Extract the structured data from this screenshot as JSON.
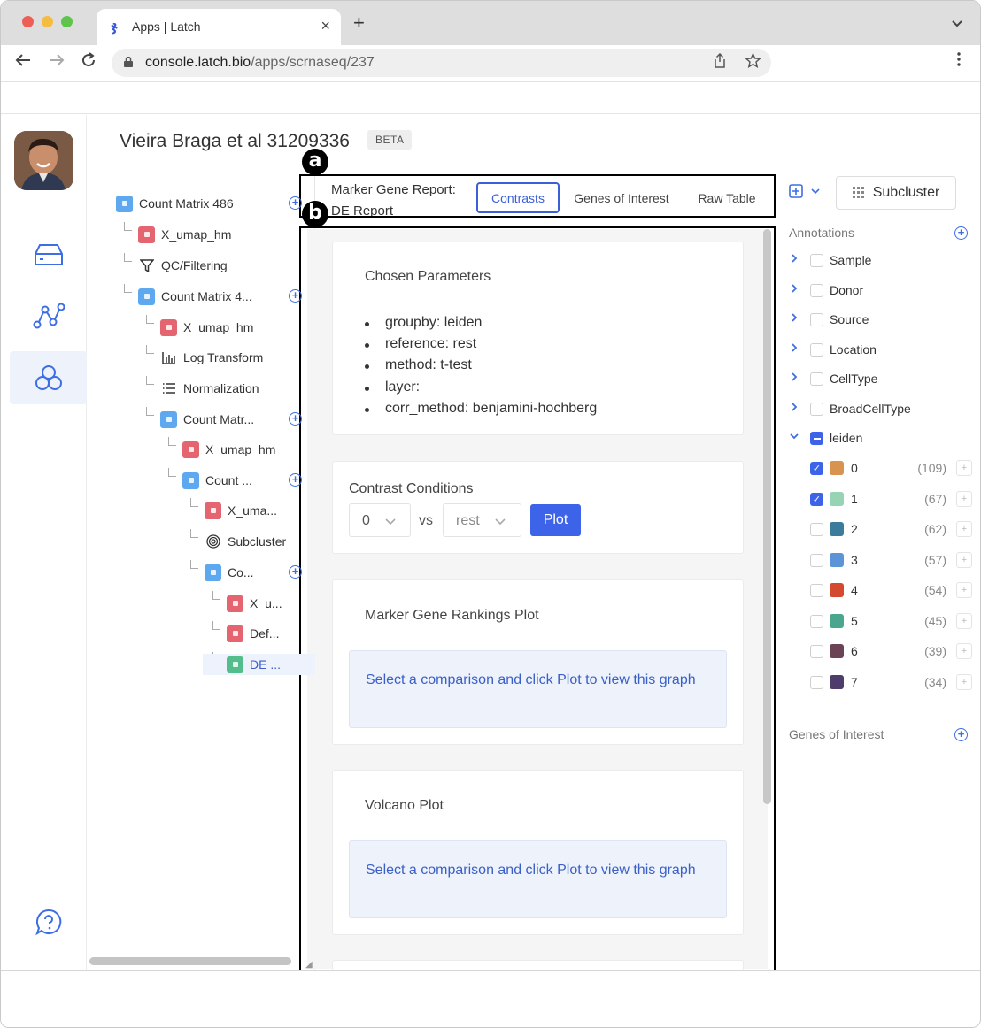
{
  "browser": {
    "tab_title": "Apps | Latch",
    "tab_close": "×",
    "new_tab": "+",
    "url_host": "console.latch.bio",
    "url_path": "/apps/scrnaseq/237"
  },
  "page": {
    "title": "Vieira Braga et al 31209336",
    "badge": "BETA"
  },
  "tree": [
    {
      "label": "Count Matrix 486",
      "icon": "blue"
    },
    {
      "label": "X_umap_hm",
      "icon": "red"
    },
    {
      "label": "QC/Filtering",
      "icon": "filter"
    },
    {
      "label": "Count Matrix 4...",
      "icon": "blue"
    },
    {
      "label": "X_umap_hm",
      "icon": "red"
    },
    {
      "label": "Log Transform",
      "icon": "bar-chart"
    },
    {
      "label": "Normalization",
      "icon": "list"
    },
    {
      "label": "Count Matr...",
      "icon": "blue"
    },
    {
      "label": "X_umap_hm",
      "icon": "red"
    },
    {
      "label": "Count ...",
      "icon": "blue"
    },
    {
      "label": "X_uma...",
      "icon": "red"
    },
    {
      "label": "Subcluster",
      "icon": "target"
    },
    {
      "label": "Co...",
      "icon": "blue"
    },
    {
      "label": "X_u...",
      "icon": "red"
    },
    {
      "label": "Def...",
      "icon": "red"
    },
    {
      "label": "DE ...",
      "icon": "green"
    }
  ],
  "annotation_badges": {
    "a": "a",
    "b": "b"
  },
  "report": {
    "title": "Marker Gene Report: DE Report",
    "tabs": [
      "Contrasts",
      "Genes of Interest",
      "Raw Table"
    ],
    "chosen_parameters": {
      "title": "Chosen Parameters",
      "items": [
        "groupby: leiden",
        "reference: rest",
        "method: t-test",
        "layer:",
        "corr_method: benjamini-hochberg"
      ]
    },
    "contrast": {
      "title": "Contrast Conditions",
      "left_value": "0",
      "vs_label": "vs",
      "right_value": "rest",
      "plot_label": "Plot"
    },
    "rankings": {
      "title": "Marker Gene Rankings Plot",
      "hint": "Select a comparison and click Plot to view this graph"
    },
    "volcano": {
      "title": "Volcano Plot",
      "hint": "Select a comparison and click Plot to view this graph"
    }
  },
  "right_panel": {
    "subcluster_label": "Subcluster",
    "annotations_label": "Annotations",
    "annotations": [
      "Sample",
      "Donor",
      "Source",
      "Location",
      "CellType",
      "BroadCellType"
    ],
    "leiden_label": "leiden",
    "clusters": [
      {
        "label": "0",
        "count": "(109)",
        "color": "#d8944f",
        "checked": true
      },
      {
        "label": "1",
        "count": "(67)",
        "color": "#97d3b5",
        "checked": true
      },
      {
        "label": "2",
        "count": "(62)",
        "color": "#3b7b9c",
        "checked": false
      },
      {
        "label": "3",
        "count": "(57)",
        "color": "#5b95d8",
        "checked": false
      },
      {
        "label": "4",
        "count": "(54)",
        "color": "#d34a2f",
        "checked": false
      },
      {
        "label": "5",
        "count": "(45)",
        "color": "#4aa78d",
        "checked": false
      },
      {
        "label": "6",
        "count": "(39)",
        "color": "#6c4356",
        "checked": false
      },
      {
        "label": "7",
        "count": "(34)",
        "color": "#4e3d6b",
        "checked": false
      }
    ],
    "genes_of_interest_label": "Genes of Interest"
  }
}
